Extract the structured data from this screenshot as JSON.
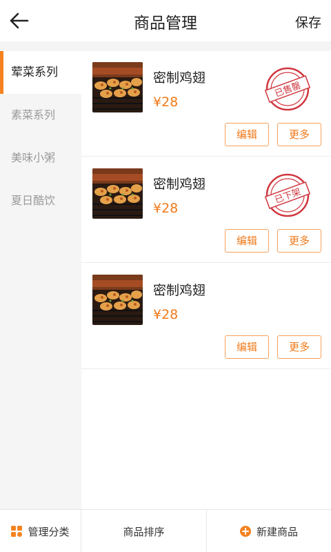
{
  "header": {
    "title": "商品管理",
    "save_label": "保存",
    "back_icon": "arrow-left-icon"
  },
  "sidebar": {
    "items": [
      {
        "label": "荤菜系列",
        "active": true
      },
      {
        "label": "素菜系列",
        "active": false
      },
      {
        "label": "美味小粥",
        "active": false
      },
      {
        "label": "夏日酷饮",
        "active": false
      }
    ]
  },
  "products": [
    {
      "name": "密制鸡翅",
      "price": "¥28",
      "stamp": "已售罄",
      "edit_label": "编辑",
      "more_label": "更多"
    },
    {
      "name": "密制鸡翅",
      "price": "¥28",
      "stamp": "已下架",
      "edit_label": "编辑",
      "more_label": "更多"
    },
    {
      "name": "密制鸡翅",
      "price": "¥28",
      "stamp": "",
      "edit_label": "编辑",
      "more_label": "更多"
    }
  ],
  "bottom_bar": {
    "manage_label": "管理分类",
    "sort_label": "商品排序",
    "new_label": "新建商品"
  },
  "colors": {
    "accent": "#f58220",
    "price": "#f07a1a",
    "stamp": "#d0353d"
  }
}
